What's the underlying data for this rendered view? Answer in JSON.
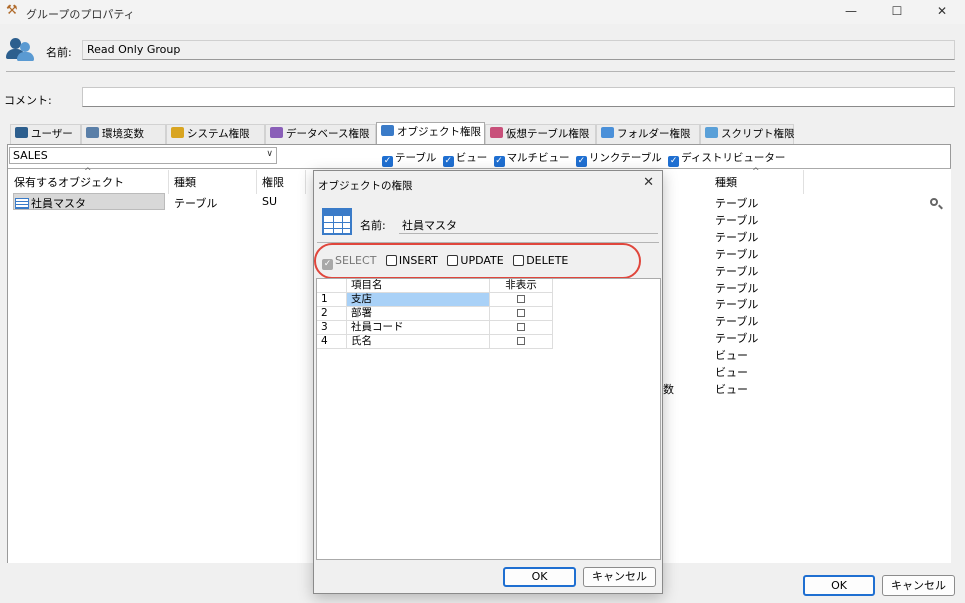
{
  "window": {
    "title": "グループのプロパティ",
    "controls": {
      "minimize": "—",
      "maximize": "☐",
      "close": "✕"
    }
  },
  "form": {
    "name_label": "名前:",
    "name_value": "Read Only Group",
    "comment_label": "コメント:",
    "comment_value": ""
  },
  "tabs": [
    {
      "label": "ユーザー",
      "color": "#2d5f8e"
    },
    {
      "label": "環境変数",
      "color": "#5a7fa8"
    },
    {
      "label": "システム権限",
      "color": "#d9a521"
    },
    {
      "label": "データベース権限",
      "color": "#8a5fb8"
    },
    {
      "label": "オブジェクト権限",
      "color": "#3a7bc8"
    },
    {
      "label": "仮想テーブル権限",
      "color": "#c8507a"
    },
    {
      "label": "フォルダー権限",
      "color": "#4a90d9"
    },
    {
      "label": "スクリプト権限",
      "color": "#5aa0d8"
    }
  ],
  "schema_select": "SALES",
  "filters": [
    "テーブル",
    "ビュー",
    "マルチビュー",
    "リンクテーブル",
    "ディストリビューター"
  ],
  "left_list": {
    "headers": [
      "保有するオブジェクト",
      "種類",
      "権限"
    ],
    "rows": [
      {
        "object": "社員マスタ",
        "type": "テーブル",
        "perm": "SU"
      }
    ]
  },
  "right_list": {
    "header": "種類",
    "partial_text": "数",
    "types": [
      "テーブル",
      "テーブル",
      "テーブル",
      "テーブル",
      "テーブル",
      "テーブル",
      "テーブル",
      "テーブル",
      "テーブル",
      "ビュー",
      "ビュー",
      "ビュー"
    ]
  },
  "main_buttons": {
    "ok": "OK",
    "cancel": "キャンセル"
  },
  "dialog": {
    "title": "オブジェクトの権限",
    "close": "✕",
    "name_label": "名前:",
    "name_value": "社員マスタ",
    "permissions": [
      "SELECT",
      "INSERT",
      "UPDATE",
      "DELETE"
    ],
    "grid_headers": [
      "項目名",
      "非表示"
    ],
    "grid_rows": [
      {
        "no": "1",
        "name": "支店"
      },
      {
        "no": "2",
        "name": "部署"
      },
      {
        "no": "3",
        "name": "社員コード"
      },
      {
        "no": "4",
        "name": "氏名"
      }
    ],
    "ok": "OK",
    "cancel": "キャンセル"
  },
  "colors": {
    "accent": "#1f6fd1",
    "highlight_oval": "#e0463c",
    "selected_row": "#a9d1f7"
  }
}
